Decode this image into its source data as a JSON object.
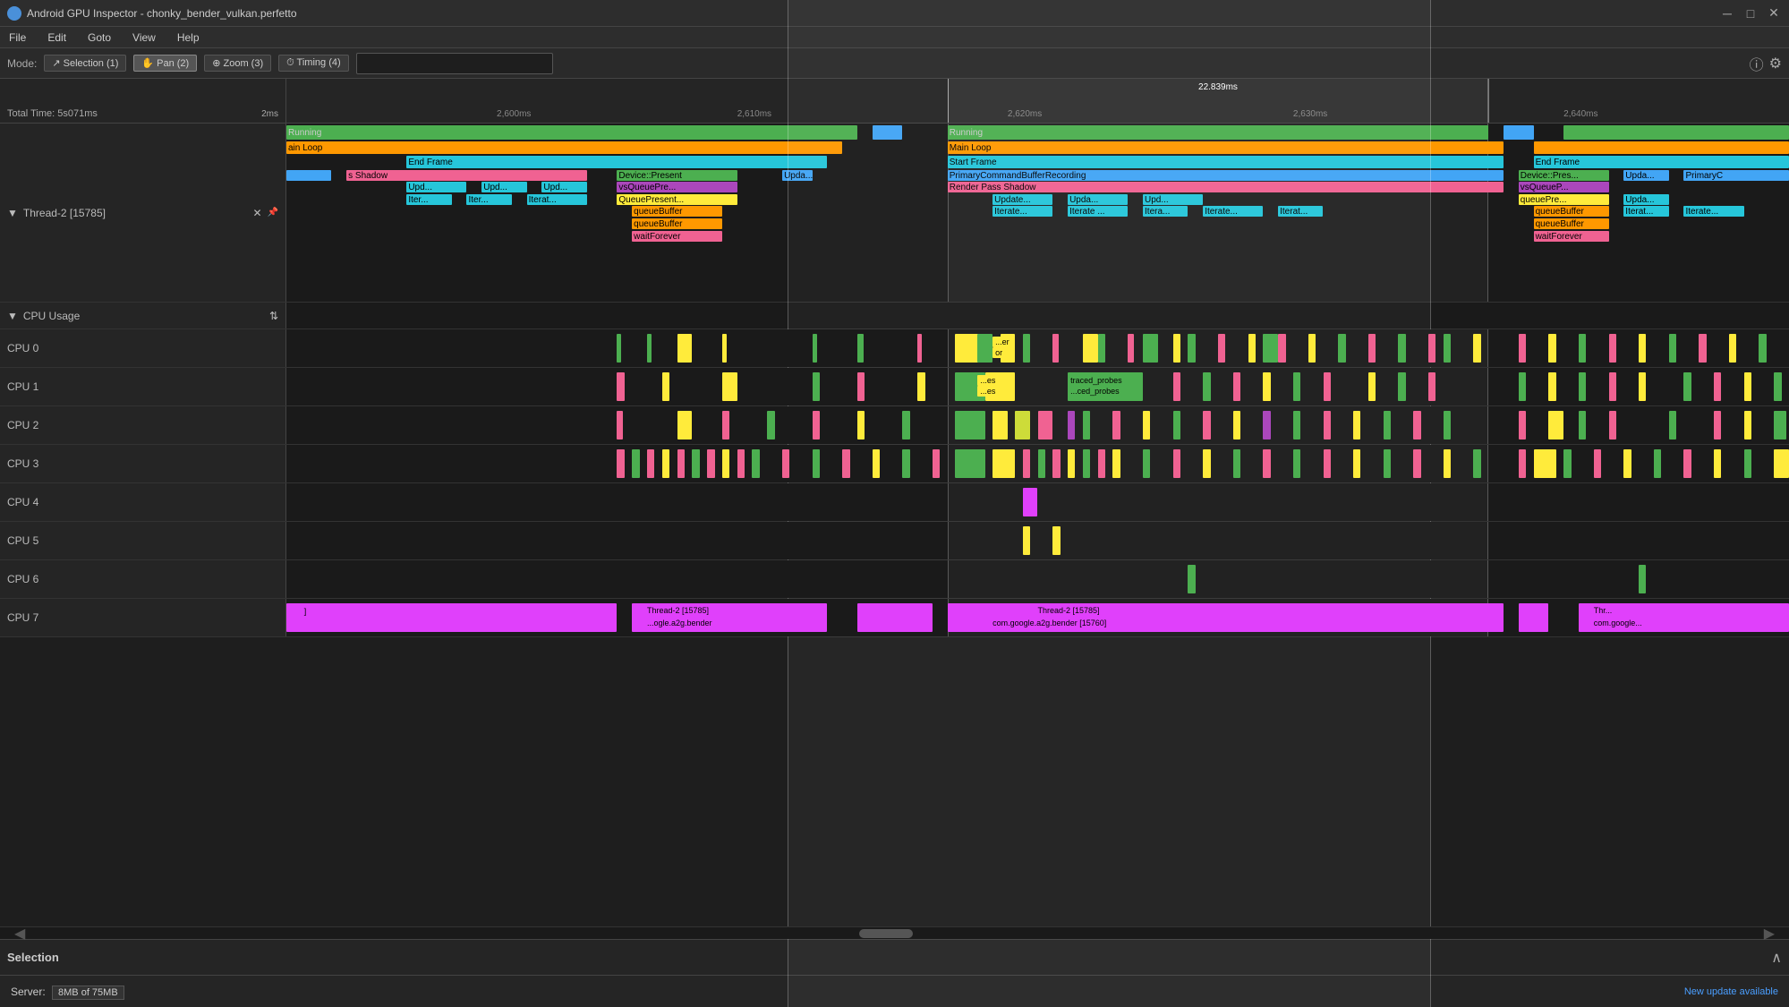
{
  "titleBar": {
    "title": "Android GPU Inspector - chonky_bender_vulkan.perfetto",
    "minBtn": "─",
    "maxBtn": "□",
    "closeBtn": "✕"
  },
  "menuBar": {
    "items": [
      "File",
      "Edit",
      "Goto",
      "View",
      "Help"
    ]
  },
  "toolbar": {
    "modeLabel": "Mode:",
    "modes": [
      {
        "label": "Selection (1)",
        "icon": "↗",
        "active": false
      },
      {
        "label": "Pan (2)",
        "icon": "✋",
        "active": true
      },
      {
        "label": "Zoom (3)",
        "icon": "🔍",
        "active": false
      },
      {
        "label": "Timing (4)",
        "icon": "⏱",
        "active": false
      }
    ],
    "searchPlaceholder": ""
  },
  "timelineHeader": {
    "totalTime": "Total Time: 5s071ms",
    "scaleLabel": "2ms",
    "ticks": [
      {
        "label": "2,600ms",
        "pct": 14
      },
      {
        "label": "2,610ms",
        "pct": 30
      },
      {
        "label": "2,620ms",
        "pct": 48
      },
      {
        "label": "2,630ms",
        "pct": 67
      },
      {
        "label": "2,640ms",
        "pct": 85
      }
    ],
    "selectionRange": {
      "label": "22.839ms",
      "startPct": 44,
      "endPct": 80
    }
  },
  "thread2": {
    "label": "Thread-2 [15785]",
    "rows": [
      {
        "label": "Running",
        "color": "green"
      },
      {
        "label": "Main Loop",
        "color": "orange"
      },
      {
        "label": "End Frame / Start Frame",
        "color": "teal"
      },
      {
        "label": "PrimaryCommandBufferRecording",
        "color": "blue"
      },
      {
        "label": "Render Pass Shadow",
        "color": "pink"
      }
    ]
  },
  "cpuUsage": {
    "label": "CPU Usage",
    "cpus": [
      {
        "label": "CPU 0"
      },
      {
        "label": "CPU 1"
      },
      {
        "label": "CPU 2"
      },
      {
        "label": "CPU 3"
      },
      {
        "label": "CPU 4"
      },
      {
        "label": "CPU 5"
      },
      {
        "label": "CPU 6"
      },
      {
        "label": "CPU 7"
      }
    ]
  },
  "bottomBar": {
    "server": "Server:",
    "memory": "8MB of 75MB",
    "updateLink": "New update available"
  },
  "selectionPanel": {
    "label": "Selection"
  }
}
